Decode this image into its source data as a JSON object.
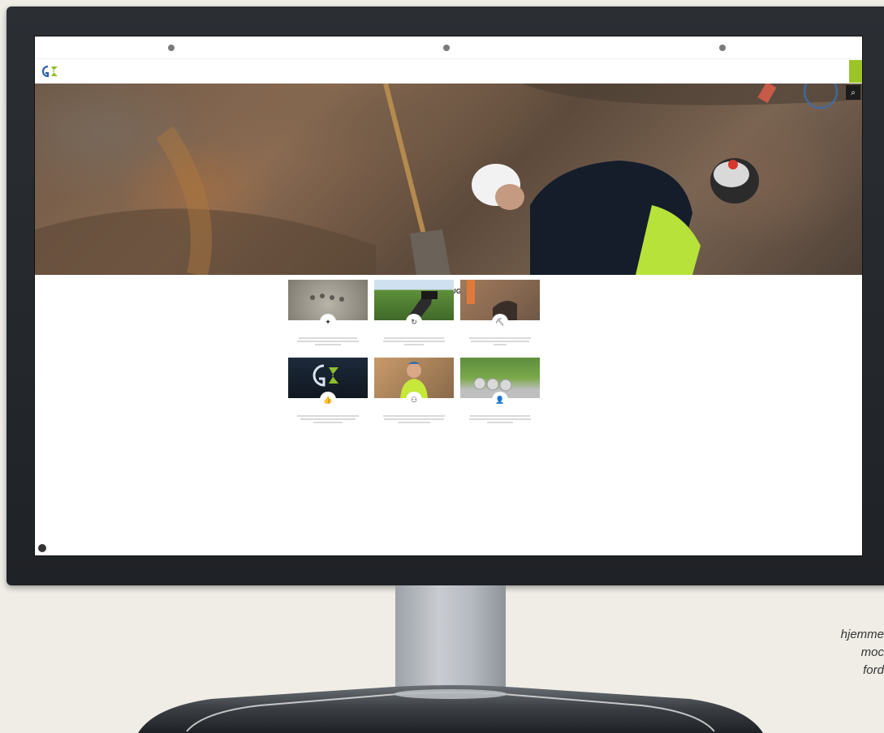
{
  "site": {
    "topbar": {
      "address": "",
      "phone": "",
      "hours": ""
    },
    "logo": {
      "line1": "",
      "line2": ""
    },
    "nav": {
      "items": [
        "",
        "",
        "",
        "",
        ""
      ],
      "cta": ""
    },
    "section_title": "HVAD SKAL DU BRUGE HJÆLP TIL?",
    "cards": [
      {
        "title": "",
        "icon": "tools-icon",
        "link": ""
      },
      {
        "title": "",
        "icon": "refresh-icon",
        "link": ""
      },
      {
        "title": "",
        "icon": "excavator-icon",
        "link": ""
      },
      {
        "title": "",
        "icon": "thumbs-up-icon",
        "link": ""
      },
      {
        "title": "",
        "icon": "binoculars-icon",
        "link": ""
      },
      {
        "title": "",
        "icon": "person-icon",
        "link": ""
      }
    ]
  },
  "caption": {
    "lines": [
      "hjemme",
      "moc",
      "ford"
    ]
  },
  "colors": {
    "accent": "#9ac428",
    "brand_blue": "#2a5fa8",
    "monitor": "#25292d"
  }
}
